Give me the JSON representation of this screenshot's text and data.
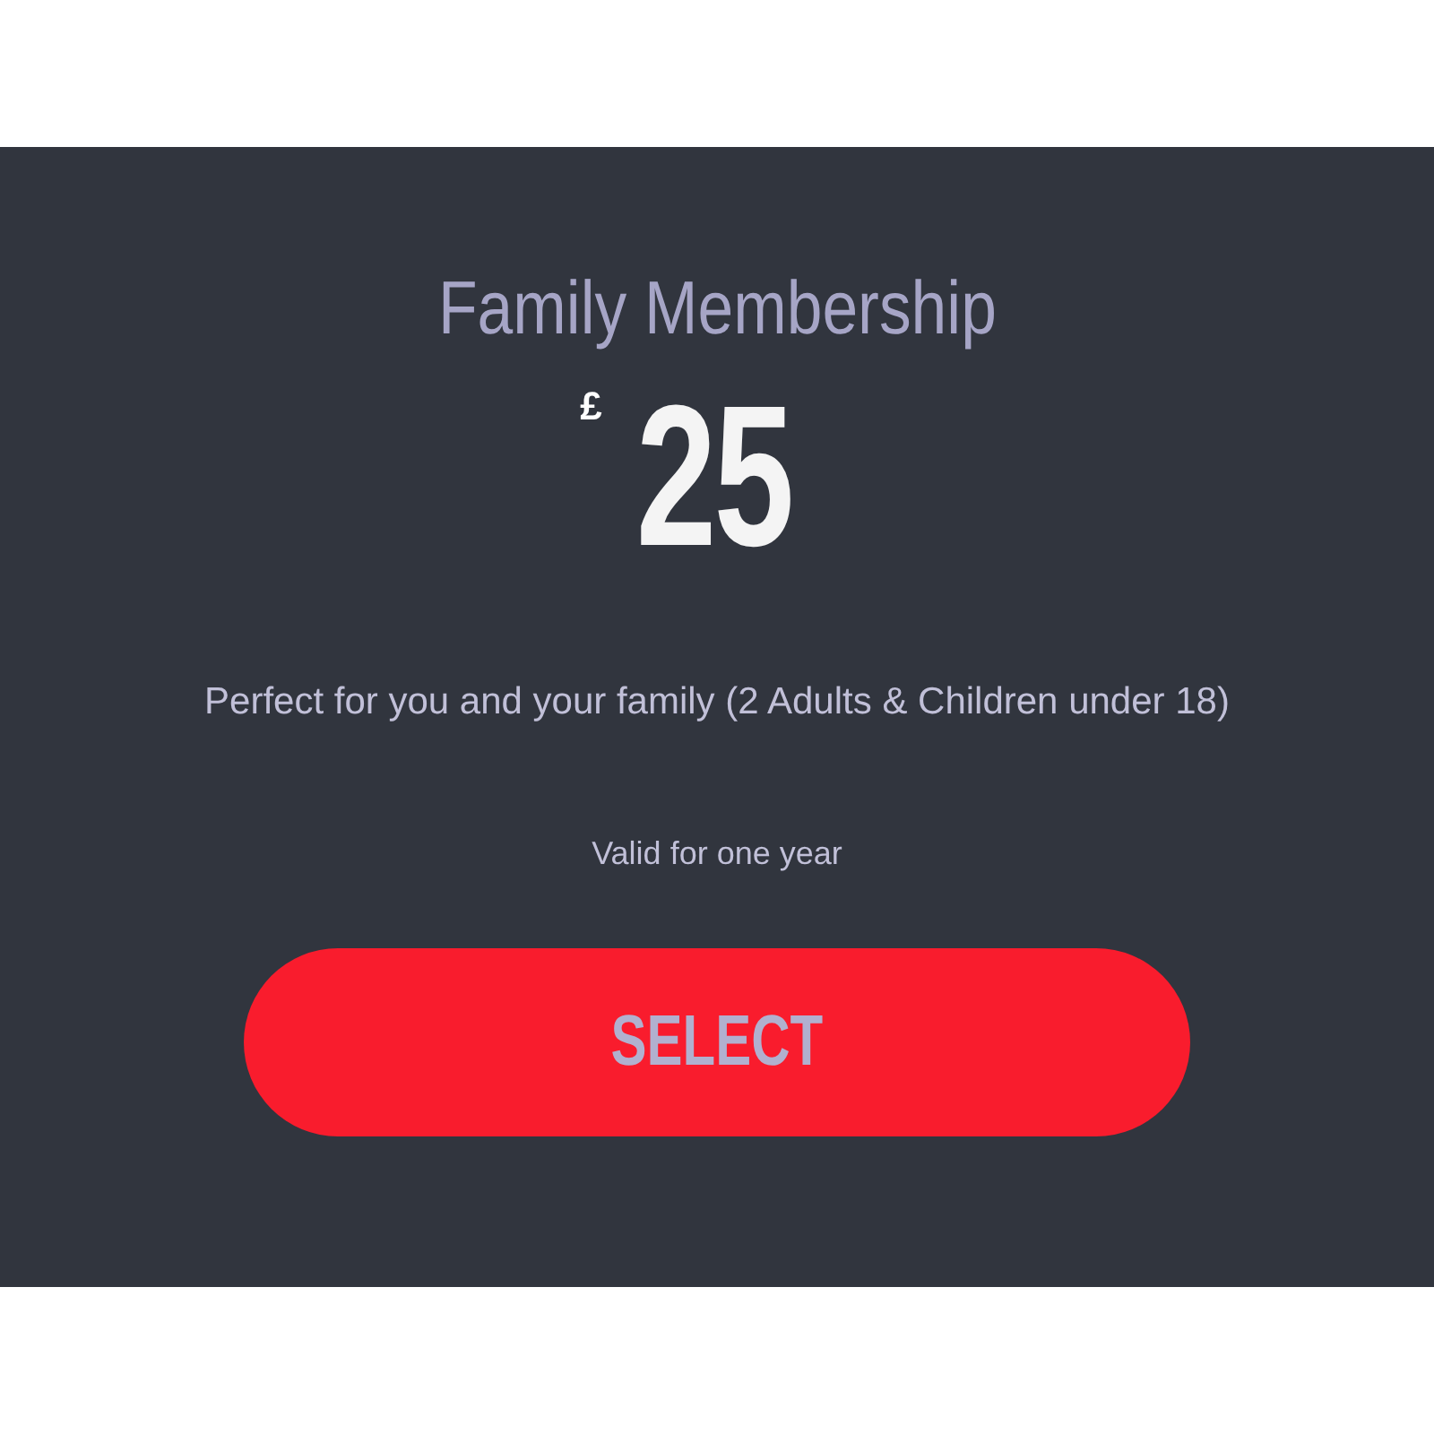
{
  "card": {
    "title": "Family Membership",
    "currency": "£",
    "price": "25",
    "description": "Perfect for you and your family (2 Adults & Children under 18)",
    "validity": "Valid for one year",
    "button": "SELECT"
  }
}
